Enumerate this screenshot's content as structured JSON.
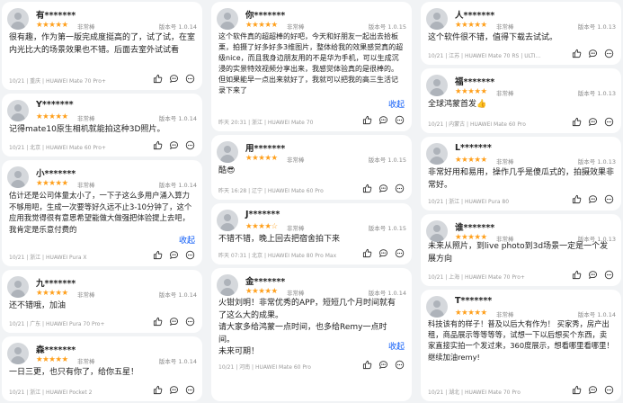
{
  "common": {
    "rating_label": "非常棒",
    "stars": "★★★★★",
    "stars_four": "★★★★☆",
    "collapse_label": "收起"
  },
  "colors": {
    "star": "#ff9f1a",
    "link": "#0a59f7",
    "card": "#ffffff",
    "page": "#f1f3f5"
  },
  "columns": [
    {
      "reviews": [
        {
          "user": "有*******",
          "version": "版本号 1.0.14",
          "text": "很有趣，作为第一版完成度挺高的了，试了试，在室内光比大的场景效果也不错。后面去室外试试看",
          "meta": "10/21 | 重庆 | HUAWEI Mate 70 Pro+"
        },
        {
          "user": "Y*******",
          "version": "版本号 1.0.14",
          "text": "记得mate10原生相机就能拍这种3D照片。",
          "meta": "10/21 | 北京 | HUAWEI Mate 60 Pro+"
        },
        {
          "user": "小*******",
          "version": "版本号 1.0.14",
          "text": "估计还是公司体量太小了，一下子这么多用户涌入算力不够用吧，生成一次要等好久远不止3-10分钟了，这个应用我觉得很有意思希望能做大做强把体验提上去吧，我肯定是乐意付费的",
          "meta": "10/21 | 浙江 | HUAWEI Pura X",
          "collapse": true
        },
        {
          "user": "九*******",
          "version": "版本号 1.0.14",
          "text": "还不错哦，加油",
          "meta": "10/21 | 广东 | HUAWEI Pura 70 Pro+"
        },
        {
          "user": "森*******",
          "version": "版本号 1.0.14",
          "text": "一日三更，也只有你了，给你五星！",
          "meta": "10/21 | 浙江 | HUAWEI Pocket 2"
        }
      ]
    },
    {
      "reviews": [
        {
          "user": "你*******",
          "version": "版本号 1.0.15",
          "text": "这个软件真的超超棒的好吧，今天和好朋友一起出去拾板栗，拍摄了好多好多3维图片，整体给我的效果感觉真的超级nice，而且我身边朋友用的不是华为手机，可以生成沉浸的实景特效视频分享出来，我感觉体验真的是很棒的。但如果能早一点出来就好了，我就可以把我的高三生活记录下来了",
          "meta": "昨天 20:31 | 浙江 | HUAWEI Mate 70",
          "collapse": true
        },
        {
          "user": "用*******",
          "version": "版本号 1.0.15",
          "text": "酷😎",
          "meta": "昨天 16:28 | 辽宁 | HUAWEI Mate 60 Pro"
        },
        {
          "user": "J*******",
          "version": "版本号 1.0.15",
          "text": "不错不错，晚上回去把宿舍拍下来",
          "meta": "昨天 07:31 | 北京 | HUAWEI Mate 80 Pro Max",
          "four": true
        },
        {
          "user": "金*******",
          "version": "版本号 1.0.14",
          "text": "火钳刘明！非常优秀的APP，短短几个月时间就有了这么大的成果。\n请大家多给鸿蒙一点时间，也多给Remy一点时间。\n未来可期！",
          "meta": "10/21 | 河南 | HUAWEI Mate 60 Pro",
          "collapse": true
        }
      ]
    },
    {
      "reviews": [
        {
          "user": "人*******",
          "version": "版本号 1.0.13",
          "text": "这个软件很不错，值得下载去试试。",
          "meta": "10/21 | 江苏 | HUAWEI Mate 70 RS | ULTI..."
        },
        {
          "user": "福*******",
          "version": "版本号 1.0.13",
          "text": "全球鸿蒙首发👍",
          "meta": "10/21 | 内蒙古 | HUAWEI Mate 60 Pro"
        },
        {
          "user": "L*******",
          "version": "版本号 1.0.13",
          "text": "非常好用和易用，操作几乎是傻瓜式的，拍摄效果非常好。",
          "meta": "10/21 | 浙江 | HUAWEI Pura 80"
        },
        {
          "user": "谁*******",
          "version": "版本号 1.0.13",
          "text": "未来从照片，到live photo到3d场景一定是一个发展方向",
          "meta": "10/21 | 上海 | HUAWEI Mate 70 Pro+"
        },
        {
          "user": "T*******",
          "version": "版本号 1.0.14",
          "text": "科技该有的样子！普及以后大有作为！ 买家秀，房产出租，商品展示等等等等，试想一下以后想买个东西，卖家直接实拍一个发过来，360度展示，想看哪里看哪里！继续加油remy!",
          "meta": "10/21 | 湖北 | HUAWEI Mate 70 Pro"
        }
      ]
    }
  ]
}
